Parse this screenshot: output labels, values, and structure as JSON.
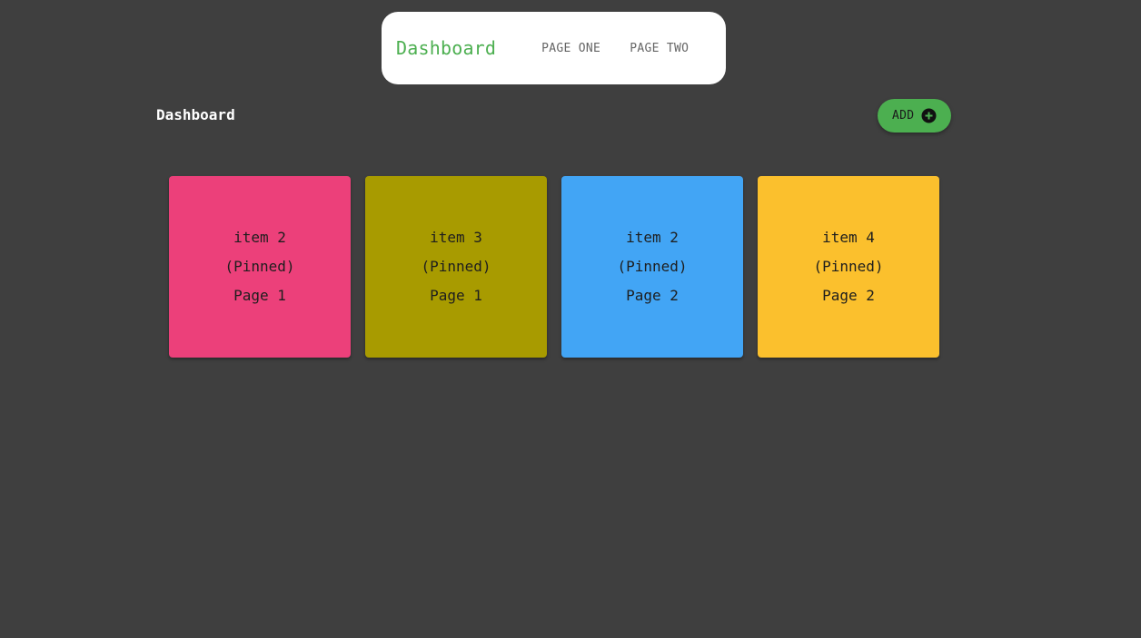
{
  "nav": {
    "brand": "Dashboard",
    "links": [
      {
        "label": "PAGE ONE"
      },
      {
        "label": "PAGE TWO"
      }
    ]
  },
  "header": {
    "title": "Dashboard",
    "add_label": "ADD",
    "add_icon": "plus-circle-icon"
  },
  "colors": {
    "background": "#3f3f3f",
    "accent": "#4caf50"
  },
  "cards": [
    {
      "title": "item 2",
      "status": "(Pinned)",
      "page": "Page 1",
      "color": "#ec407a"
    },
    {
      "title": "item 3",
      "status": "(Pinned)",
      "page": "Page 1",
      "color": "#a89b00"
    },
    {
      "title": "item 2",
      "status": "(Pinned)",
      "page": "Page 2",
      "color": "#42a5f5"
    },
    {
      "title": "item 4",
      "status": "(Pinned)",
      "page": "Page 2",
      "color": "#fbc02d"
    }
  ]
}
